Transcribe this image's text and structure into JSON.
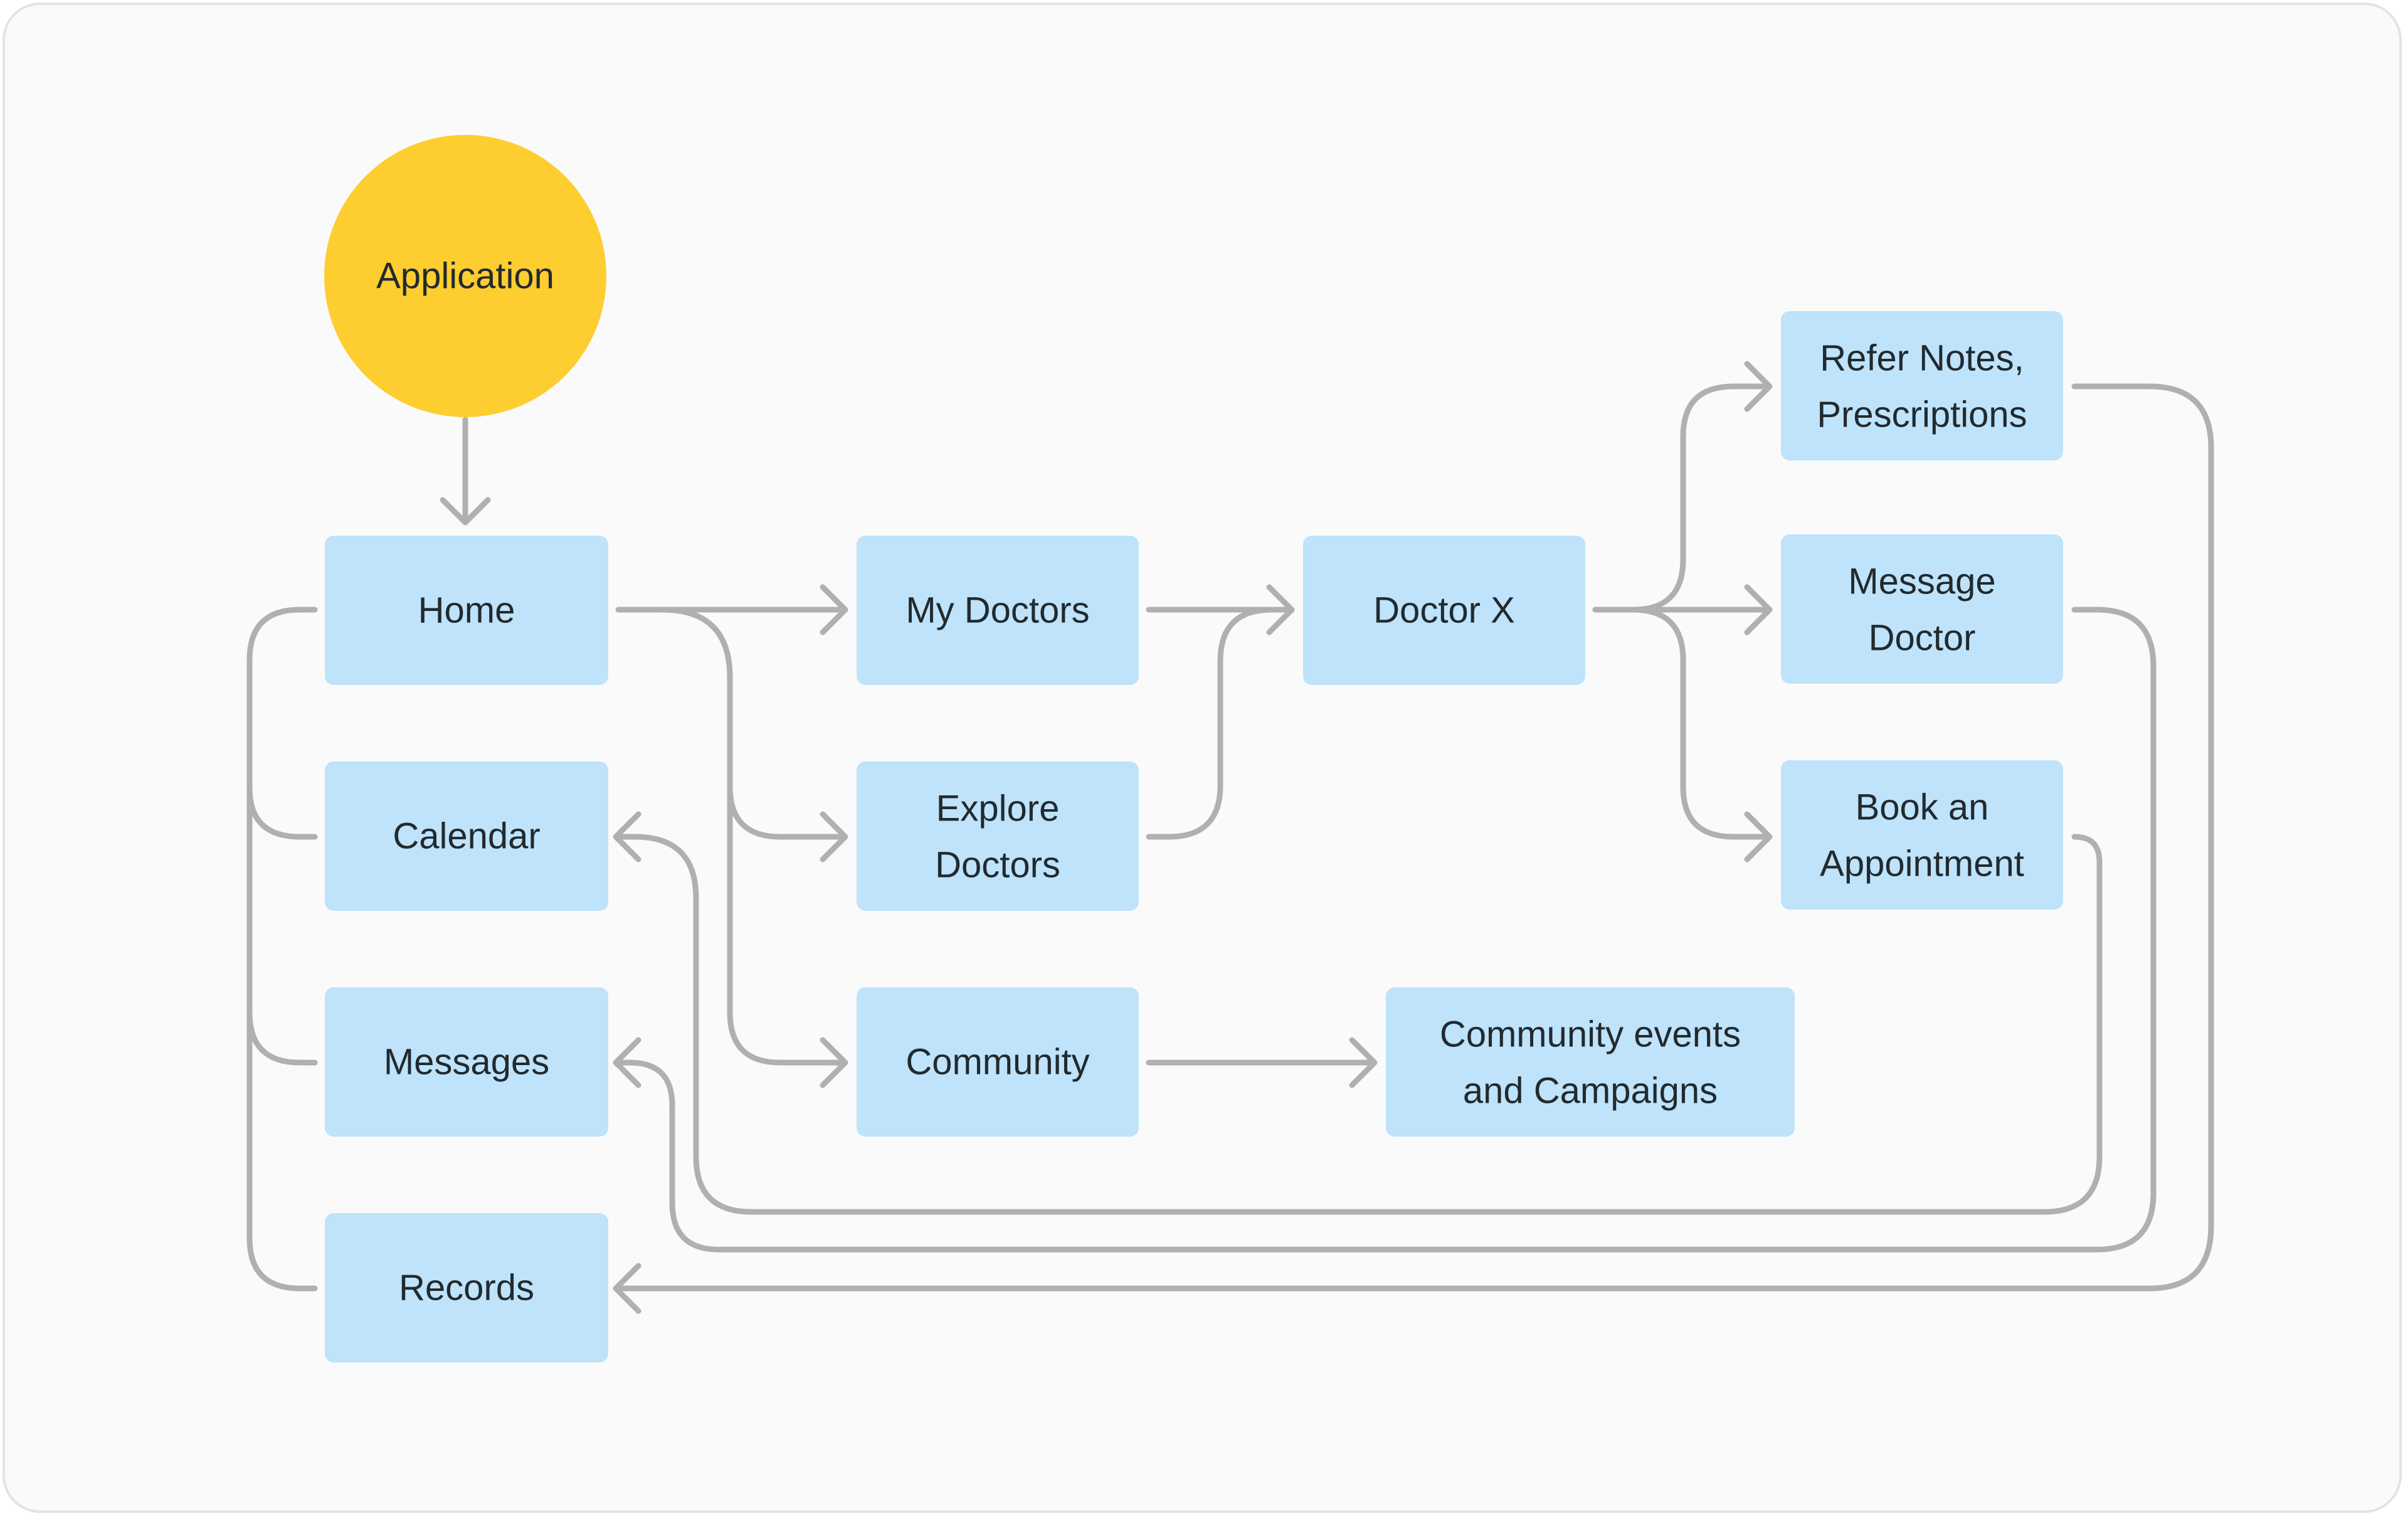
{
  "diagram": {
    "root": {
      "label": "Application"
    },
    "nodes": {
      "home": {
        "lines": [
          "Home"
        ]
      },
      "calendar": {
        "lines": [
          "Calendar"
        ]
      },
      "messages": {
        "lines": [
          "Messages"
        ]
      },
      "records": {
        "lines": [
          "Records"
        ]
      },
      "my_doctors": {
        "lines": [
          "My Doctors"
        ]
      },
      "explore_doctors": {
        "lines": [
          "Explore",
          "Doctors"
        ]
      },
      "community": {
        "lines": [
          "Community"
        ]
      },
      "doctor_x": {
        "lines": [
          "Doctor X"
        ]
      },
      "community_events": {
        "lines": [
          "Community events",
          "and Campaigns"
        ]
      },
      "refer_notes": {
        "lines": [
          "Refer Notes,",
          "Prescriptions"
        ]
      },
      "message_doctor": {
        "lines": [
          "Message",
          "Doctor"
        ]
      },
      "book_appointment": {
        "lines": [
          "Book an",
          "Appointment"
        ]
      }
    },
    "colors": {
      "root_fill": "#fecd2f",
      "node_fill": "#bee3fb",
      "connector": "#b0b0b0",
      "text": "#222a2e",
      "background": "#fafafa"
    }
  }
}
